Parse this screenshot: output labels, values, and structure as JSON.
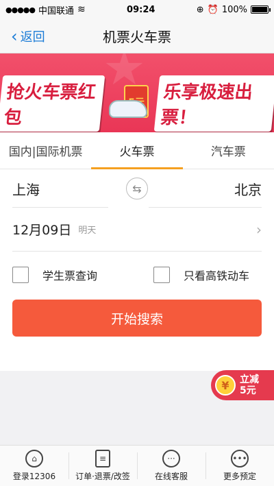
{
  "status": {
    "carrier": "中国联通",
    "time": "09:24",
    "battery": "100%"
  },
  "nav": {
    "back": "返回",
    "title": "机票火车票"
  },
  "banner": {
    "left": "抢火车票红包",
    "mid": "5元",
    "right": "乐享极速出票！"
  },
  "tabs": [
    "国内|国际机票",
    "火车票",
    "汽车票"
  ],
  "route": {
    "from": "上海",
    "to": "北京"
  },
  "date": {
    "value": "12月09日",
    "sub": "明天"
  },
  "options": {
    "student": "学生票查询",
    "highspeed": "只看高铁动车"
  },
  "search_label": "开始搜索",
  "promo": {
    "coin": "¥",
    "line1": "立减",
    "line2": "5元"
  },
  "tabbar": [
    "登录12306",
    "订单·退票/改签",
    "在线客服",
    "更多预定"
  ]
}
